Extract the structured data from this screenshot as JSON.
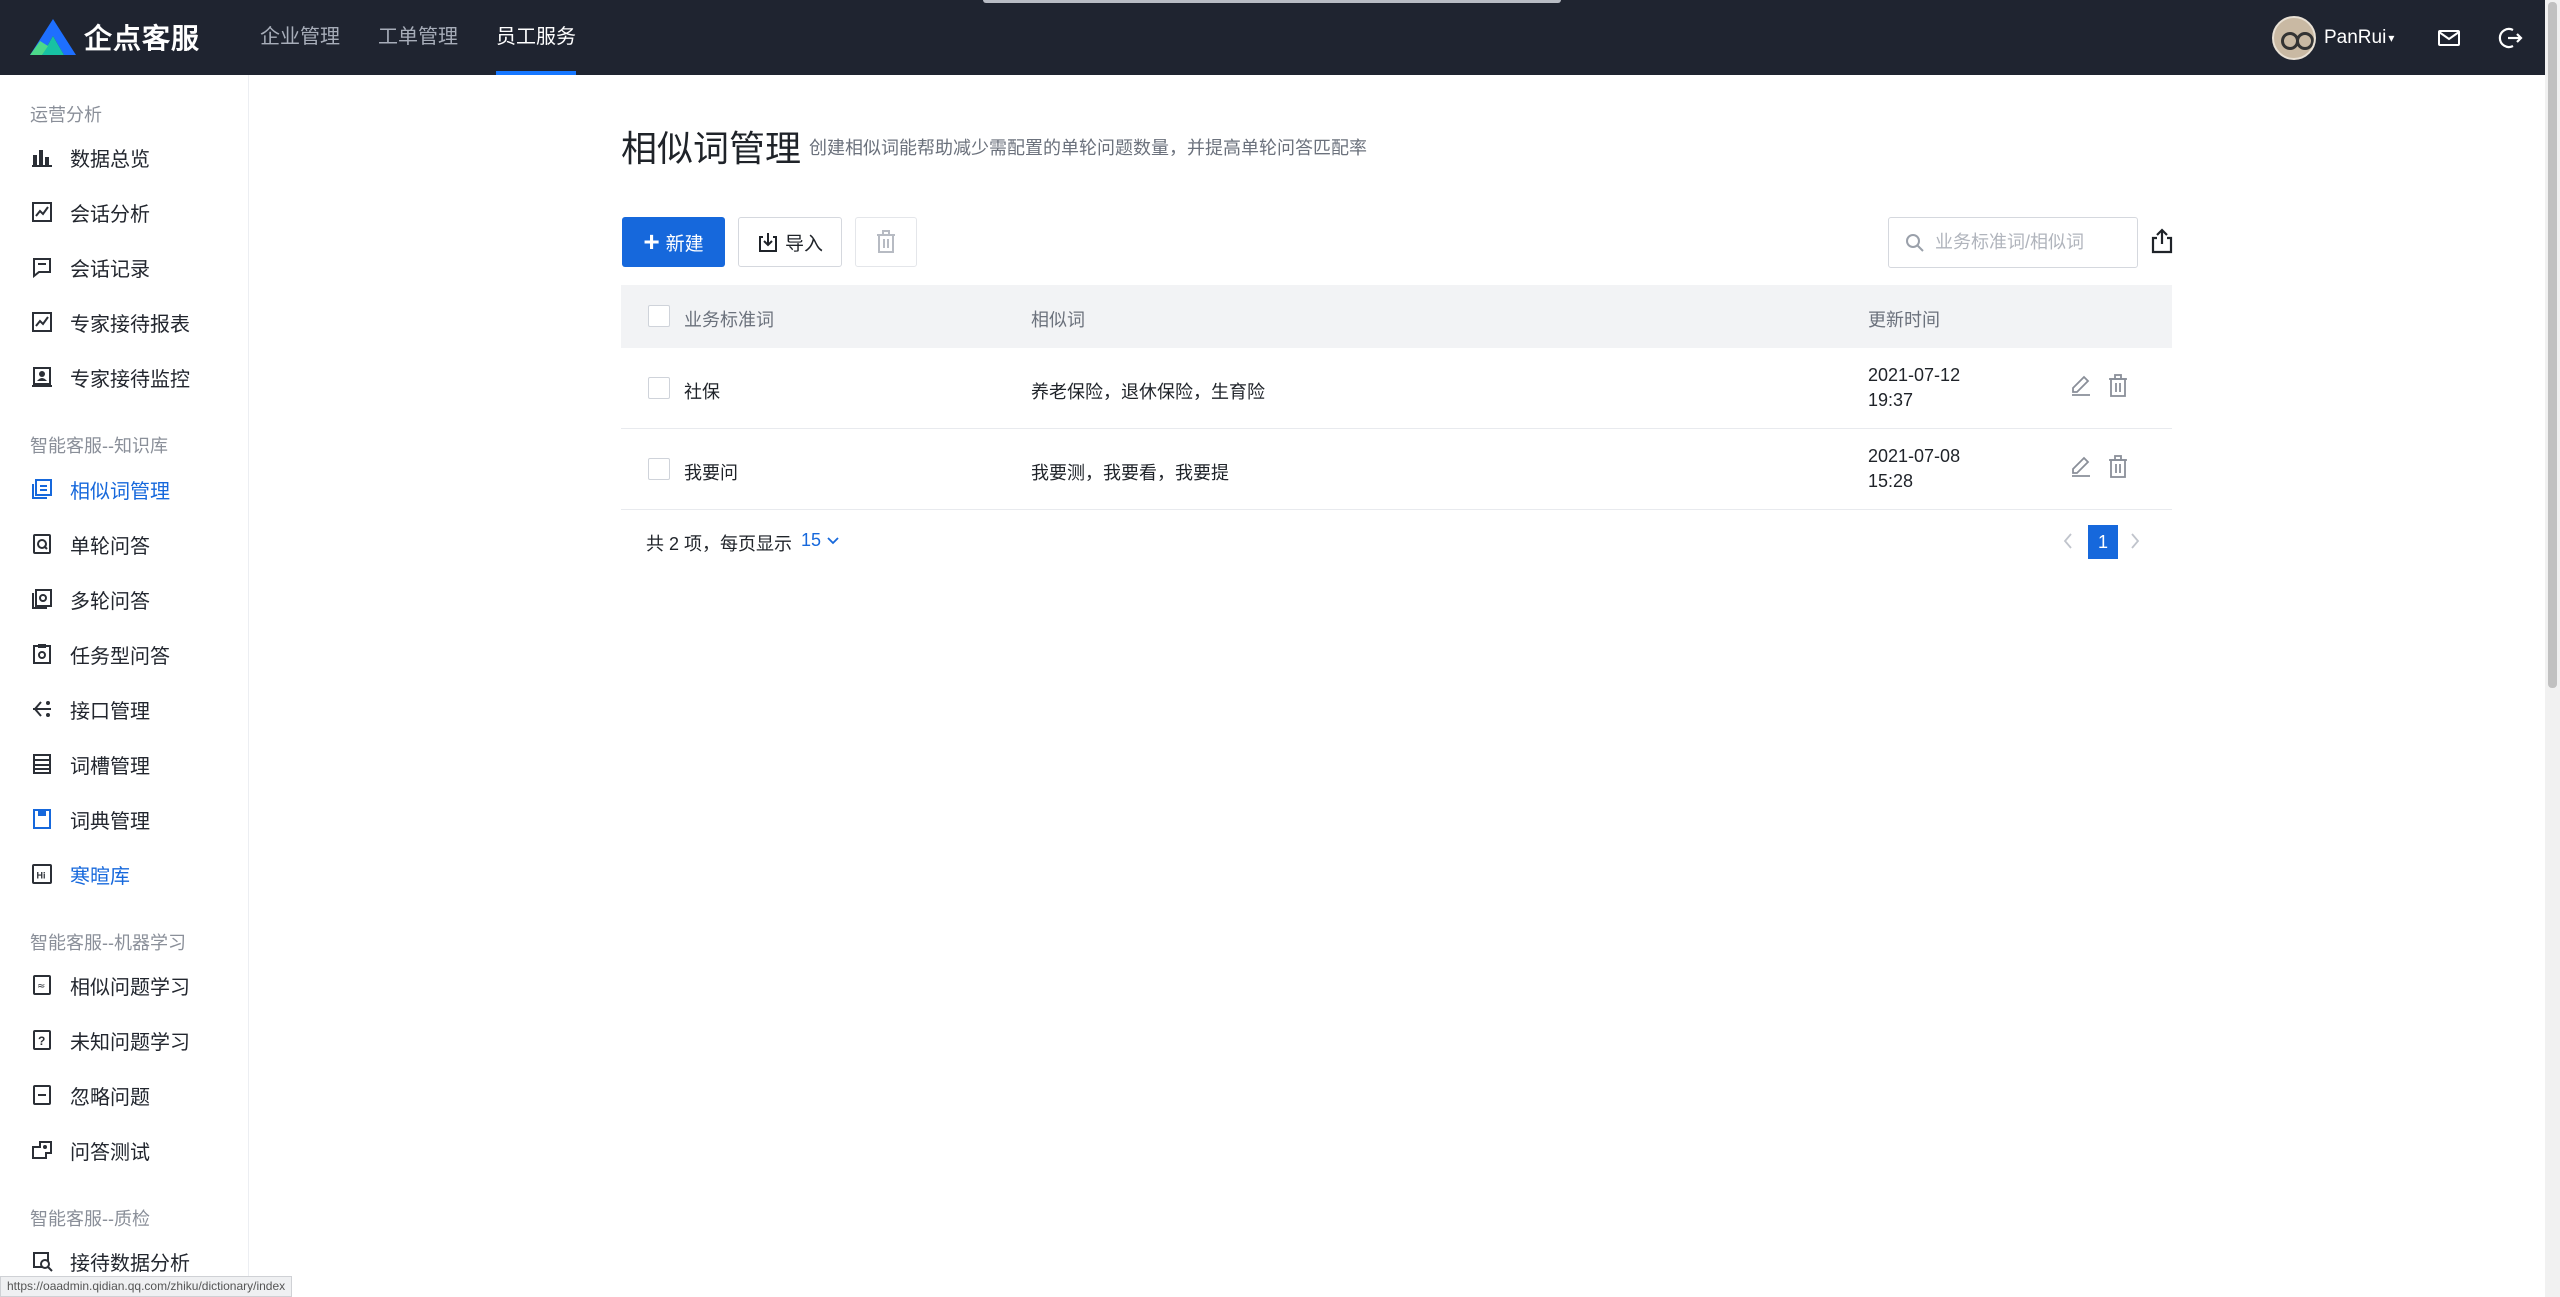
{
  "brand": {
    "name": "企点客服",
    "colors": {
      "accent": "#1668dc",
      "topbar": "#1f2430"
    }
  },
  "topnav": {
    "items": [
      {
        "label": "企业管理",
        "active": false
      },
      {
        "label": "工单管理",
        "active": false
      },
      {
        "label": "员工服务",
        "active": true
      }
    ]
  },
  "user": {
    "name": "PanRui",
    "caret": "▾",
    "icons": [
      "mail-icon",
      "logout-icon"
    ]
  },
  "sidebar": {
    "groups": [
      {
        "title": "运营分析",
        "items": [
          {
            "label": "数据总览",
            "icon": "bar-chart-icon"
          },
          {
            "label": "会话分析",
            "icon": "line-chart-icon"
          },
          {
            "label": "会话记录",
            "icon": "chat-record-icon"
          },
          {
            "label": "专家接待报表",
            "icon": "line-chart-icon"
          },
          {
            "label": "专家接待监控",
            "icon": "monitor-icon"
          }
        ]
      },
      {
        "title": "智能客服--知识库",
        "items": [
          {
            "label": "相似词管理",
            "icon": "similar-words-icon",
            "active": true
          },
          {
            "label": "单轮问答",
            "icon": "single-qa-icon"
          },
          {
            "label": "多轮问答",
            "icon": "multi-qa-icon"
          },
          {
            "label": "任务型问答",
            "icon": "task-qa-icon"
          },
          {
            "label": "接口管理",
            "icon": "api-icon"
          },
          {
            "label": "词槽管理",
            "icon": "slot-icon"
          },
          {
            "label": "词典管理",
            "icon": "dictionary-icon"
          },
          {
            "label": "寒暄库",
            "icon": "greeting-icon"
          }
        ]
      },
      {
        "title": "智能客服--机器学习",
        "items": [
          {
            "label": "相似问题学习",
            "icon": "similar-question-icon"
          },
          {
            "label": "未知问题学习",
            "icon": "unknown-question-icon"
          },
          {
            "label": "忽略问题",
            "icon": "ignore-icon"
          },
          {
            "label": "问答测试",
            "icon": "qa-test-icon"
          }
        ]
      },
      {
        "title": "智能客服--质检",
        "items": [
          {
            "label": "接待数据分析",
            "icon": "data-analysis-icon"
          }
        ]
      }
    ]
  },
  "page": {
    "title": "相似词管理",
    "description": "创建相似词能帮助减少需配置的单轮问题数量，并提高单轮问答匹配率"
  },
  "toolbar": {
    "new_label": "新建",
    "import_label": "导入",
    "search_placeholder": "业务标准词/相似词"
  },
  "table": {
    "columns": [
      "业务标准词",
      "相似词",
      "更新时间"
    ],
    "rows": [
      {
        "term": "社保",
        "similar": "养老保险，退休保险，生育险",
        "date": "2021-07-12",
        "time": "19:37"
      },
      {
        "term": "我要问",
        "similar": "我要测，我要看，我要提",
        "date": "2021-07-08",
        "time": "15:28"
      }
    ]
  },
  "pagination": {
    "total_text": "共 2 项，每页显示",
    "page_size": "15",
    "current_page": "1"
  },
  "status_bar": {
    "url": "https://oaadmin.qidian.qq.com/zhiku/dictionary/index"
  }
}
